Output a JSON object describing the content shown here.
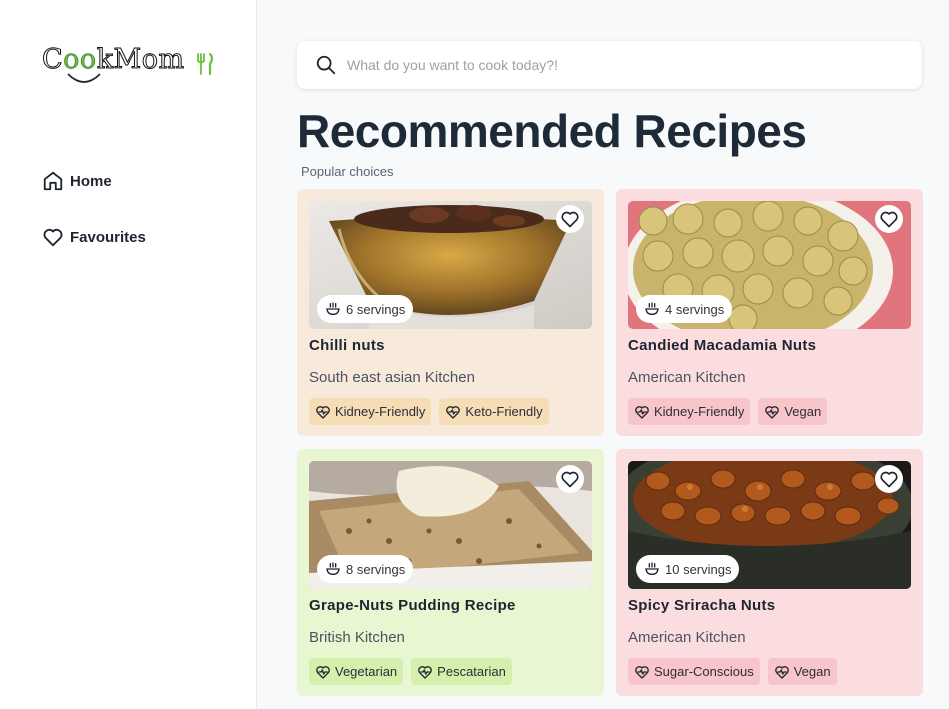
{
  "brand": {
    "logo_text": "CookMom",
    "logo_text_parts": [
      "C",
      "oo",
      "kMom"
    ]
  },
  "nav": [
    {
      "label": "Home",
      "icon": "home-icon"
    },
    {
      "label": "Favourites",
      "icon": "heart-icon"
    }
  ],
  "search": {
    "placeholder": "What do you want to cook today?!",
    "value": ""
  },
  "page": {
    "title": "Recommended Recipes",
    "subtitle": "Popular choices"
  },
  "recipes": [
    {
      "title": "Chilli nuts",
      "cuisine": "South east asian Kitchen",
      "servings": "6 servings",
      "tags": [
        "Kidney-Friendly",
        "Keto-Friendly"
      ],
      "card_color": "#f8eadb",
      "tag_color": "#f6ddb6"
    },
    {
      "title": "Candied Macadamia Nuts",
      "cuisine": "American Kitchen",
      "servings": "4 servings",
      "tags": [
        "Kidney-Friendly",
        "Vegan"
      ],
      "card_color": "#fbdde0",
      "tag_color": "#f7c5ca"
    },
    {
      "title": "Grape-Nuts Pudding Recipe",
      "cuisine": "British Kitchen",
      "servings": "8 servings",
      "tags": [
        "Vegetarian",
        "Pescatarian"
      ],
      "card_color": "#e9f6d2",
      "tag_color": "#d4f0ac"
    },
    {
      "title": "Spicy Sriracha Nuts",
      "cuisine": "American Kitchen",
      "servings": "10 servings",
      "tags": [
        "Sugar-Conscious",
        "Vegan"
      ],
      "card_color": "#fbdde0",
      "tag_color": "#f7c5ca"
    }
  ]
}
